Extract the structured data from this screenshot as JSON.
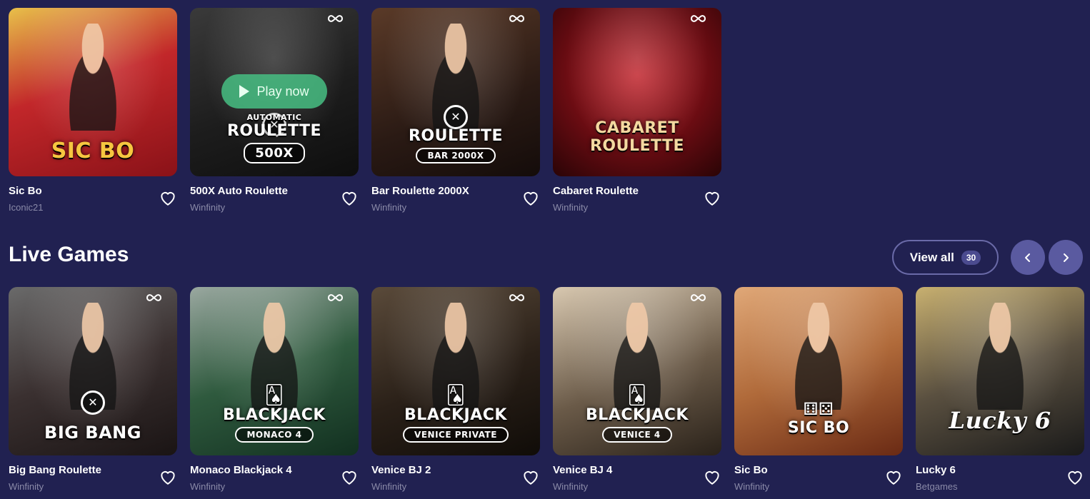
{
  "colors": {
    "background": "#212151",
    "provider_text": "#8a8aa8",
    "nav_button": "#5a5aa0",
    "view_all_border": "#6a6aa8"
  },
  "top_row": [
    {
      "title": "Sic Bo",
      "provider": "Iconic21",
      "logo_main": "SIC BO",
      "logo_sub": "",
      "bg": "linear-gradient(160deg,#e8c04a 0%,#c2272a 45%,#8a1218 100%)",
      "watermark": false,
      "play_label": ""
    },
    {
      "title": "500X Auto Roulette",
      "provider": "Winfinity",
      "logo_main": "ROULETTE",
      "logo_top": "AUTOMATIC",
      "logo_sub": "500X",
      "bg": "linear-gradient(160deg,#3a3a3a 0%,#1d1d1d 55%,#0e0e0e 100%)",
      "watermark": true,
      "play_label": "Play now"
    },
    {
      "title": "Bar Roulette 2000X",
      "provider": "Winfinity",
      "logo_main": "ROULETTE",
      "logo_sub": "BAR 2000X",
      "bg": "linear-gradient(160deg,#5a3a28 0%,#2a1a14 60%,#140c0a 100%)",
      "watermark": true,
      "play_label": ""
    },
    {
      "title": "Cabaret Roulette",
      "provider": "Winfinity",
      "logo_main": "CABARET ROULETTE",
      "logo_sub": "",
      "bg": "radial-gradient(circle at 50% 40%,#c2262e 0%,#6a0c12 55%,#2a0406 100%)",
      "watermark": true,
      "play_label": ""
    }
  ],
  "live_section": {
    "title": "Live Games",
    "view_all_label": "View all",
    "view_all_count": "30",
    "prev_icon": "chevron-left",
    "next_icon": "chevron-right"
  },
  "live_row": [
    {
      "title": "Big Bang Roulette",
      "provider": "Winfinity",
      "logo_main": "BIG BANG",
      "logo_sub": "",
      "bg": "linear-gradient(160deg,#6a6a6a 0%,#3a3030 50%,#1a1414 100%)",
      "watermark": true
    },
    {
      "title": "Monaco Blackjack 4",
      "provider": "Winfinity",
      "logo_main": "BLACKJACK",
      "logo_sub": "MONACO 4",
      "bg": "linear-gradient(160deg,#9aa8a0 0%,#2f5a3e 50%,#123020 100%)",
      "watermark": true
    },
    {
      "title": "Venice BJ 2",
      "provider": "Winfinity",
      "logo_main": "BLACKJACK",
      "logo_sub": "VENICE PRIVATE",
      "bg": "linear-gradient(160deg,#5a4a3a 0%,#2a2018 55%,#100c08 100%)",
      "watermark": true
    },
    {
      "title": "Venice BJ 4",
      "provider": "Winfinity",
      "logo_main": "BLACKJACK",
      "logo_sub": "VENICE 4",
      "bg": "linear-gradient(160deg,#d8c8b0 0%,#6a5a48 55%,#2a221a 100%)",
      "watermark": true
    },
    {
      "title": "Sic Bo",
      "provider": "Winfinity",
      "logo_main": "SIC BO",
      "logo_sub": "",
      "bg": "linear-gradient(160deg,#e0a878 0%,#b06a3a 50%,#6a2a14 100%)",
      "watermark": false
    },
    {
      "title": "Lucky 6",
      "provider": "Betgames",
      "logo_main": "Lucky 6",
      "logo_sub": "",
      "bg": "linear-gradient(160deg,#c8b070 0%,#5a5040 50%,#1a1a1a 100%)",
      "watermark": false
    }
  ]
}
